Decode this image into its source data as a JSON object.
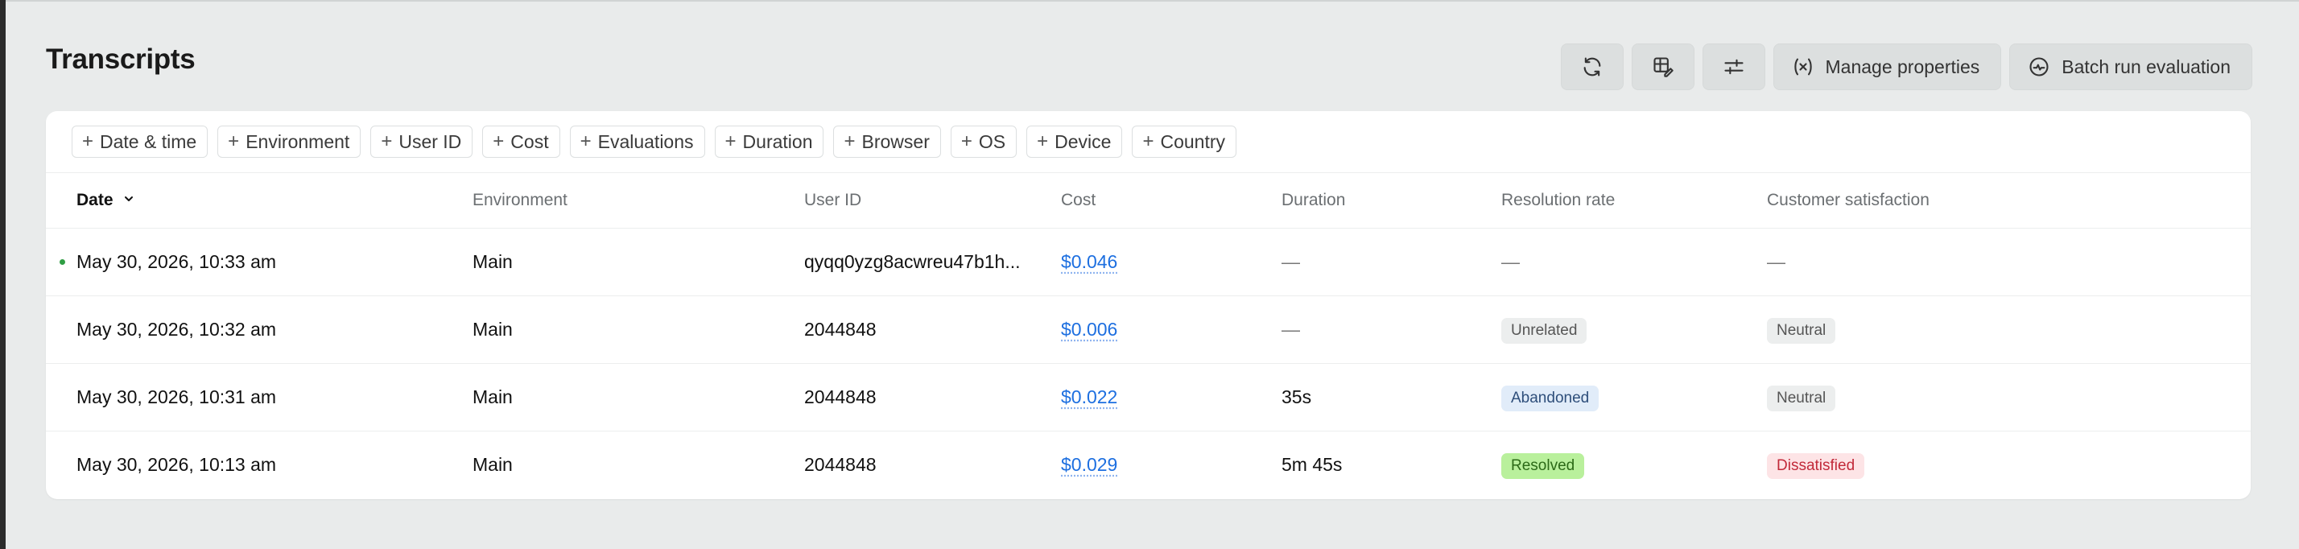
{
  "page": {
    "title": "Transcripts"
  },
  "toolbar": {
    "refresh_icon": "refresh-icon",
    "layout_icon": "table-edit-icon",
    "filters_icon": "sliders-icon",
    "manage_properties_label": "Manage properties",
    "batch_run_label": "Batch run evaluation"
  },
  "filters": [
    "Date & time",
    "Environment",
    "User ID",
    "Cost",
    "Evaluations",
    "Duration",
    "Browser",
    "OS",
    "Device",
    "Country"
  ],
  "table": {
    "columns": {
      "date": "Date",
      "environment": "Environment",
      "user_id": "User ID",
      "cost": "Cost",
      "duration": "Duration",
      "resolution_rate": "Resolution rate",
      "customer_satisfaction": "Customer satisfaction"
    },
    "sort": {
      "column": "Date",
      "direction": "descending"
    },
    "rows": [
      {
        "date": "May 30, 2026, 10:33 am",
        "environment": "Main",
        "user_id": "qyqq0yzg8acwreu47b1h...",
        "cost": "$0.046",
        "duration": "—",
        "resolution_rate": "—",
        "customer_satisfaction": "—",
        "live": true
      },
      {
        "date": "May 30, 2026, 10:32 am",
        "environment": "Main",
        "user_id": "2044848",
        "cost": "$0.006",
        "duration": "—",
        "resolution_rate": "Unrelated",
        "customer_satisfaction": "Neutral"
      },
      {
        "date": "May 30, 2026, 10:31 am",
        "environment": "Main",
        "user_id": "2044848",
        "cost": "$0.022",
        "duration": "35s",
        "resolution_rate": "Abandoned",
        "customer_satisfaction": "Neutral"
      },
      {
        "date": "May 30, 2026, 10:13 am",
        "environment": "Main",
        "user_id": "2044848",
        "cost": "$0.029",
        "duration": "5m 45s",
        "resolution_rate": "Resolved",
        "customer_satisfaction": "Dissatisfied"
      }
    ]
  },
  "colors": {
    "link": "#1d6fe0",
    "live_dot": "#2f9e44",
    "badge_resolved": "#b9f09c",
    "badge_dissatisfied": "#fde4e6",
    "badge_abandoned": "#e1ecf9"
  }
}
